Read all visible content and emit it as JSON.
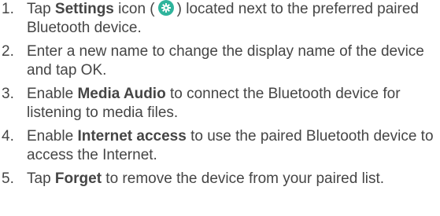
{
  "steps": [
    {
      "num": "1.",
      "parts": {
        "a": "Tap ",
        "b": "Settings",
        "c": " icon (",
        "d": ") located next to the preferred paired Bluetooth device."
      }
    },
    {
      "num": "2.",
      "parts": {
        "a": "Enter a new name to change the display name of the device and tap OK."
      }
    },
    {
      "num": "3.",
      "parts": {
        "a": "Enable ",
        "b": "Media Audio",
        "c": " to connect the Bluetooth device for listening to media files."
      }
    },
    {
      "num": "4.",
      "parts": {
        "a": "Enable ",
        "b": "Internet access",
        "c": " to use the paired Bluetooth device to access the Internet."
      }
    },
    {
      "num": "5.",
      "parts": {
        "a": "Tap ",
        "b": "Forget",
        "c": " to remove the device from your paired list."
      }
    }
  ],
  "icons": {
    "settings": "gear-icon"
  },
  "colors": {
    "text": "#454545",
    "icon_bg": "#2fb49c",
    "icon_fg": "#ffffff"
  }
}
